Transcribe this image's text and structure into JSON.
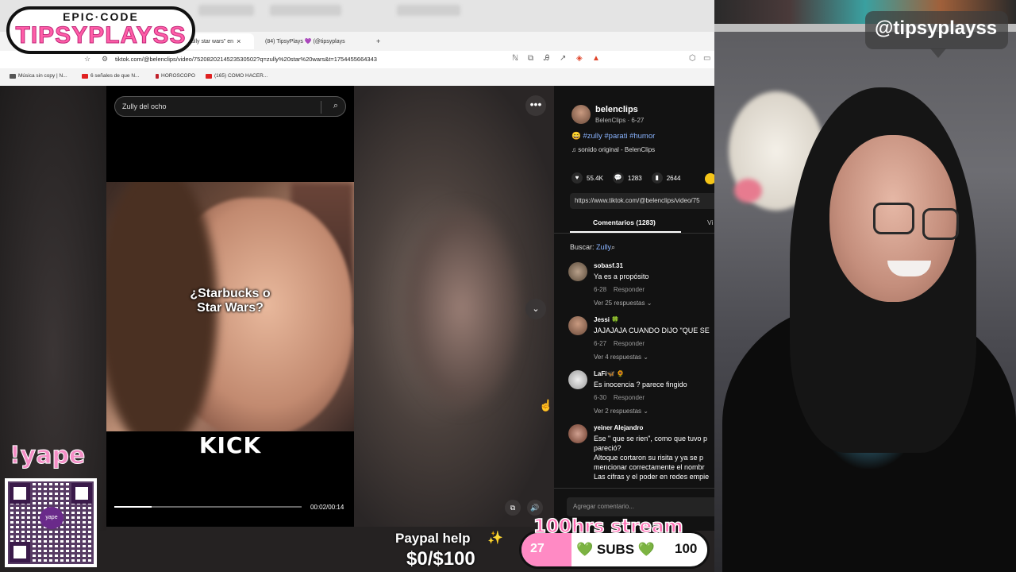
{
  "browser": {
    "tabs": [
      {
        "label": "ully star wars\" en",
        "close": "×"
      },
      {
        "label": "(84) TipsyPlays 💜 (@tipsyplays"
      }
    ],
    "new_tab": "+",
    "url": "tiktok.com/@belenclips/video/7520820214523530502?q=zully%20star%20wars&t=1754455664343",
    "bookmarks": [
      "Música sin copy | N...",
      "6 señales de que N...",
      "HOROSCOPO",
      "(165) COMO HACER..."
    ]
  },
  "logo": {
    "top": "EPIC·CODE",
    "main": "TIPSYPLAYSS"
  },
  "player": {
    "search_value": "Zully del ocho",
    "caption": "¿Starbucks o Star Wars?",
    "watermark": "KICK",
    "time": "00:02/00:14",
    "progress": 0.2
  },
  "panel": {
    "author_name": "belenclips",
    "author_meta": "BelenClips · 6-27",
    "tags": "😄 #zully #parati #humor",
    "music": "♫  sonido original - BelenClips",
    "stats": {
      "likes": "55.4K",
      "comments": "1283",
      "saves": "2644"
    },
    "share_url": "https://www.tiktok.com/@belenclips/video/75",
    "tab_comments": "Comentarios (1283)",
    "tab_other": "Vi",
    "search_label": "Buscar:",
    "search_term": "Zully",
    "comments": [
      {
        "user": "sobasf.31",
        "text": "Ya es a propósito",
        "date": "6-28",
        "reply": "Responder",
        "more": "Ver 25 respuestas"
      },
      {
        "user": "Jessi 🍀",
        "text": "JAJAJAJA CUANDO DIJO \"QUE SE",
        "date": "6-27",
        "reply": "Responder",
        "more": "Ver 4 respuestas"
      },
      {
        "user": "LaFi🦋 🌻",
        "text": "Es inocencia ? parece fingido",
        "date": "6-30",
        "reply": "Responder",
        "more": "Ver 2 respuestas"
      },
      {
        "user": "yeiner Alejandro",
        "text1": "Ese \" que se rien\", como que tuvo p",
        "text2": "pareció?",
        "text3": "Altoque cortaron su risita y ya se p",
        "text4": "mencionar correctamente el nombr",
        "text5": "Las cifras y el poder en redes empie"
      }
    ],
    "add_comment_placeholder": "Agregar comentario..."
  },
  "cam": {
    "handle": "@tipsyplayss"
  },
  "overlay": {
    "yape": "!yape",
    "yape_badge": "yape",
    "paypal_line1": "Paypal help",
    "paypal_line2": "$0/$100",
    "goal_title": "100hrs stream",
    "goal_current": "27",
    "goal_label": "💚 SUBS 💚",
    "goal_max": "100",
    "goal_fraction": 0.27
  }
}
